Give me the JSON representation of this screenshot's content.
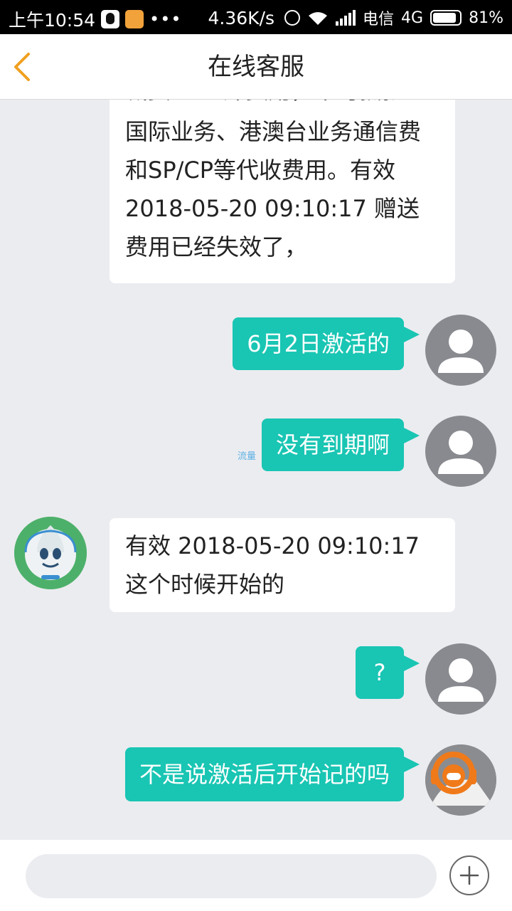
{
  "status_bar": {
    "time": "上午10:54",
    "more": "•••",
    "speed": "4.36K/s",
    "carrier": "电信",
    "network": "4G",
    "battery": "81%",
    "battery_level": 0.81,
    "icons": [
      "qq-icon",
      "cat-app-icon",
      "alarm-icon",
      "wifi-icon",
      "signal-icon",
      "battery-icon"
    ]
  },
  "header": {
    "title": "在线客服",
    "back_icon": "chevron-left-icon",
    "accent_color": "#f0a020"
  },
  "messages": [
    {
      "side": "in",
      "avatar": "none",
      "text": "国际业务、港澳台业务通信费和SP/CP等代收费用。有效 2018-05-20 09:10:17 赠送费用已经失效了，",
      "partial_top_line": "减费、CP外费用，不可抵扣"
    },
    {
      "side": "out",
      "avatar": "user-avatar-icon",
      "text": "6月2日激活的"
    },
    {
      "side": "out",
      "avatar": "user-avatar-icon",
      "text": "没有到期啊"
    },
    {
      "side": "in",
      "avatar": "robot-agent-avatar-icon",
      "text": "有效 2018-05-20 09:10:17 这个时候开始的"
    },
    {
      "side": "out",
      "avatar": "user-avatar-icon",
      "text": "?"
    },
    {
      "side": "out",
      "avatar": "headset-agent-avatar-icon",
      "text": "不是说激活后开始记的吗"
    }
  ],
  "watermark": "流量",
  "input": {
    "value": "",
    "placeholder": ""
  },
  "colors": {
    "outgoing_bubble": "#19c5b3",
    "incoming_bubble": "#ffffff",
    "background": "#ebecf0"
  }
}
